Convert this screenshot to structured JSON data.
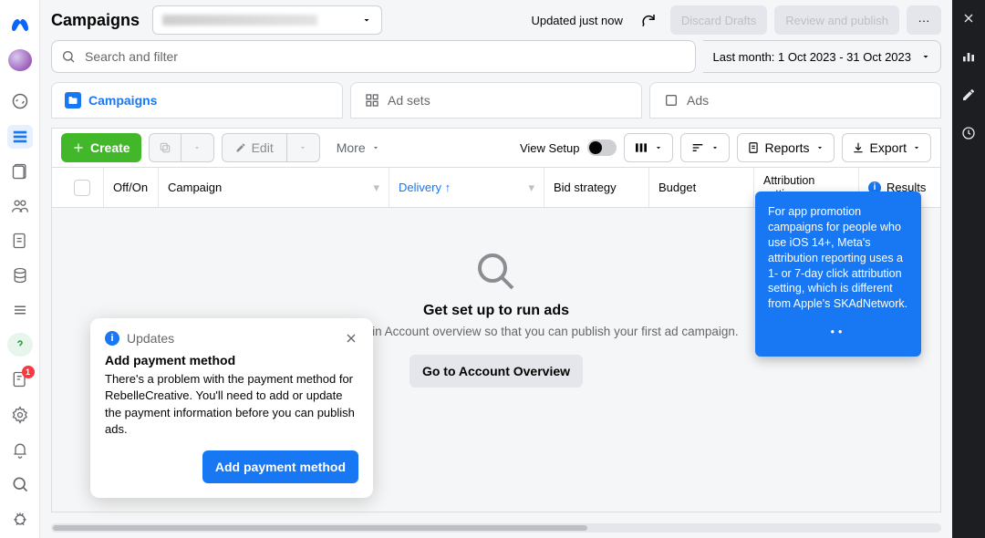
{
  "header": {
    "title": "Campaigns",
    "updated": "Updated just now",
    "discard": "Discard Drafts",
    "review": "Review and publish"
  },
  "search": {
    "placeholder": "Search and filter"
  },
  "daterange": {
    "label": "Last month: 1 Oct 2023 - 31 Oct 2023"
  },
  "tabs": {
    "campaigns": "Campaigns",
    "adsets": "Ad sets",
    "ads": "Ads"
  },
  "toolbar": {
    "create": "Create",
    "edit": "Edit",
    "more": "More",
    "view_setup": "View Setup",
    "reports": "Reports",
    "export": "Export"
  },
  "columns": {
    "offon": "Off/On",
    "campaign": "Campaign",
    "delivery": "Delivery",
    "bid": "Bid strategy",
    "budget": "Budget",
    "attribution": "Attribution\nsetting",
    "results": "Results"
  },
  "empty": {
    "title": "Get set up to run ads",
    "subtitle": "Confirm a few details in Account overview so that you can publish your first ad campaign.",
    "cta": "Go to Account Overview"
  },
  "tooltip": {
    "text": "For app promotion campaigns for people who use iOS 14+, Meta's attribution reporting uses a 1- or 7-day click attribution setting, which is different from Apple's SKAdNetwork."
  },
  "updates": {
    "label": "Updates",
    "title": "Add payment method",
    "body": "There's a problem with the payment method for RebelleCreative. You'll need to add or update the payment information before you can publish ads.",
    "cta": "Add payment method"
  },
  "leftRail": {
    "badge": "1"
  }
}
